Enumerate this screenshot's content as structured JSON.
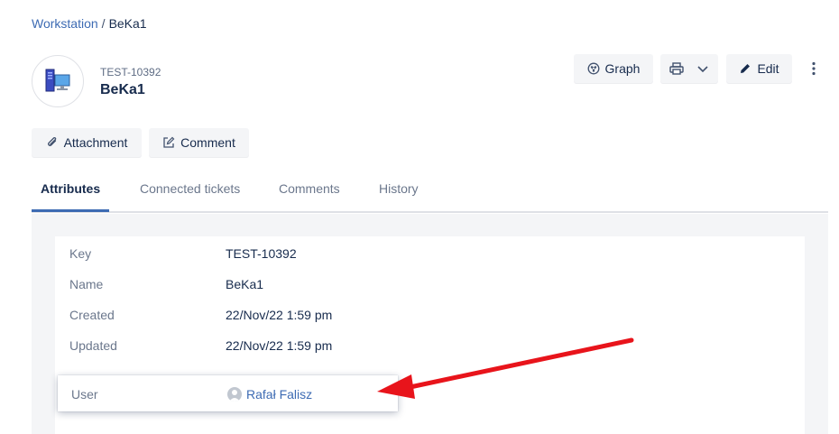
{
  "breadcrumb": {
    "parent": "Workstation",
    "separator": "/",
    "current": "BeKa1"
  },
  "object": {
    "key": "TEST-10392",
    "title": "BeKa1",
    "icon": "workstation-icon"
  },
  "toolbar": {
    "graph_label": "Graph",
    "edit_label": "Edit",
    "print_icon": "printer-icon",
    "more_icon": "vertical-ellipsis-icon"
  },
  "actions": {
    "attachment_label": "Attachment",
    "comment_label": "Comment"
  },
  "tabs": [
    {
      "label": "Attributes",
      "active": true
    },
    {
      "label": "Connected tickets",
      "active": false
    },
    {
      "label": "Comments",
      "active": false
    },
    {
      "label": "History",
      "active": false
    }
  ],
  "attributes": [
    {
      "label": "Key",
      "value": "TEST-10392"
    },
    {
      "label": "Name",
      "value": "BeKa1"
    },
    {
      "label": "Created",
      "value": "22/Nov/22 1:59 pm"
    },
    {
      "label": "Updated",
      "value": "22/Nov/22 1:59 pm"
    },
    {
      "label": "User",
      "value": "Rafał Falisz",
      "type": "user-link"
    }
  ],
  "colors": {
    "link": "#3d6bb3",
    "tab_underline": "#3d6bb3",
    "annotation_arrow": "#e8141b",
    "panel_bg": "#f4f5f7"
  }
}
